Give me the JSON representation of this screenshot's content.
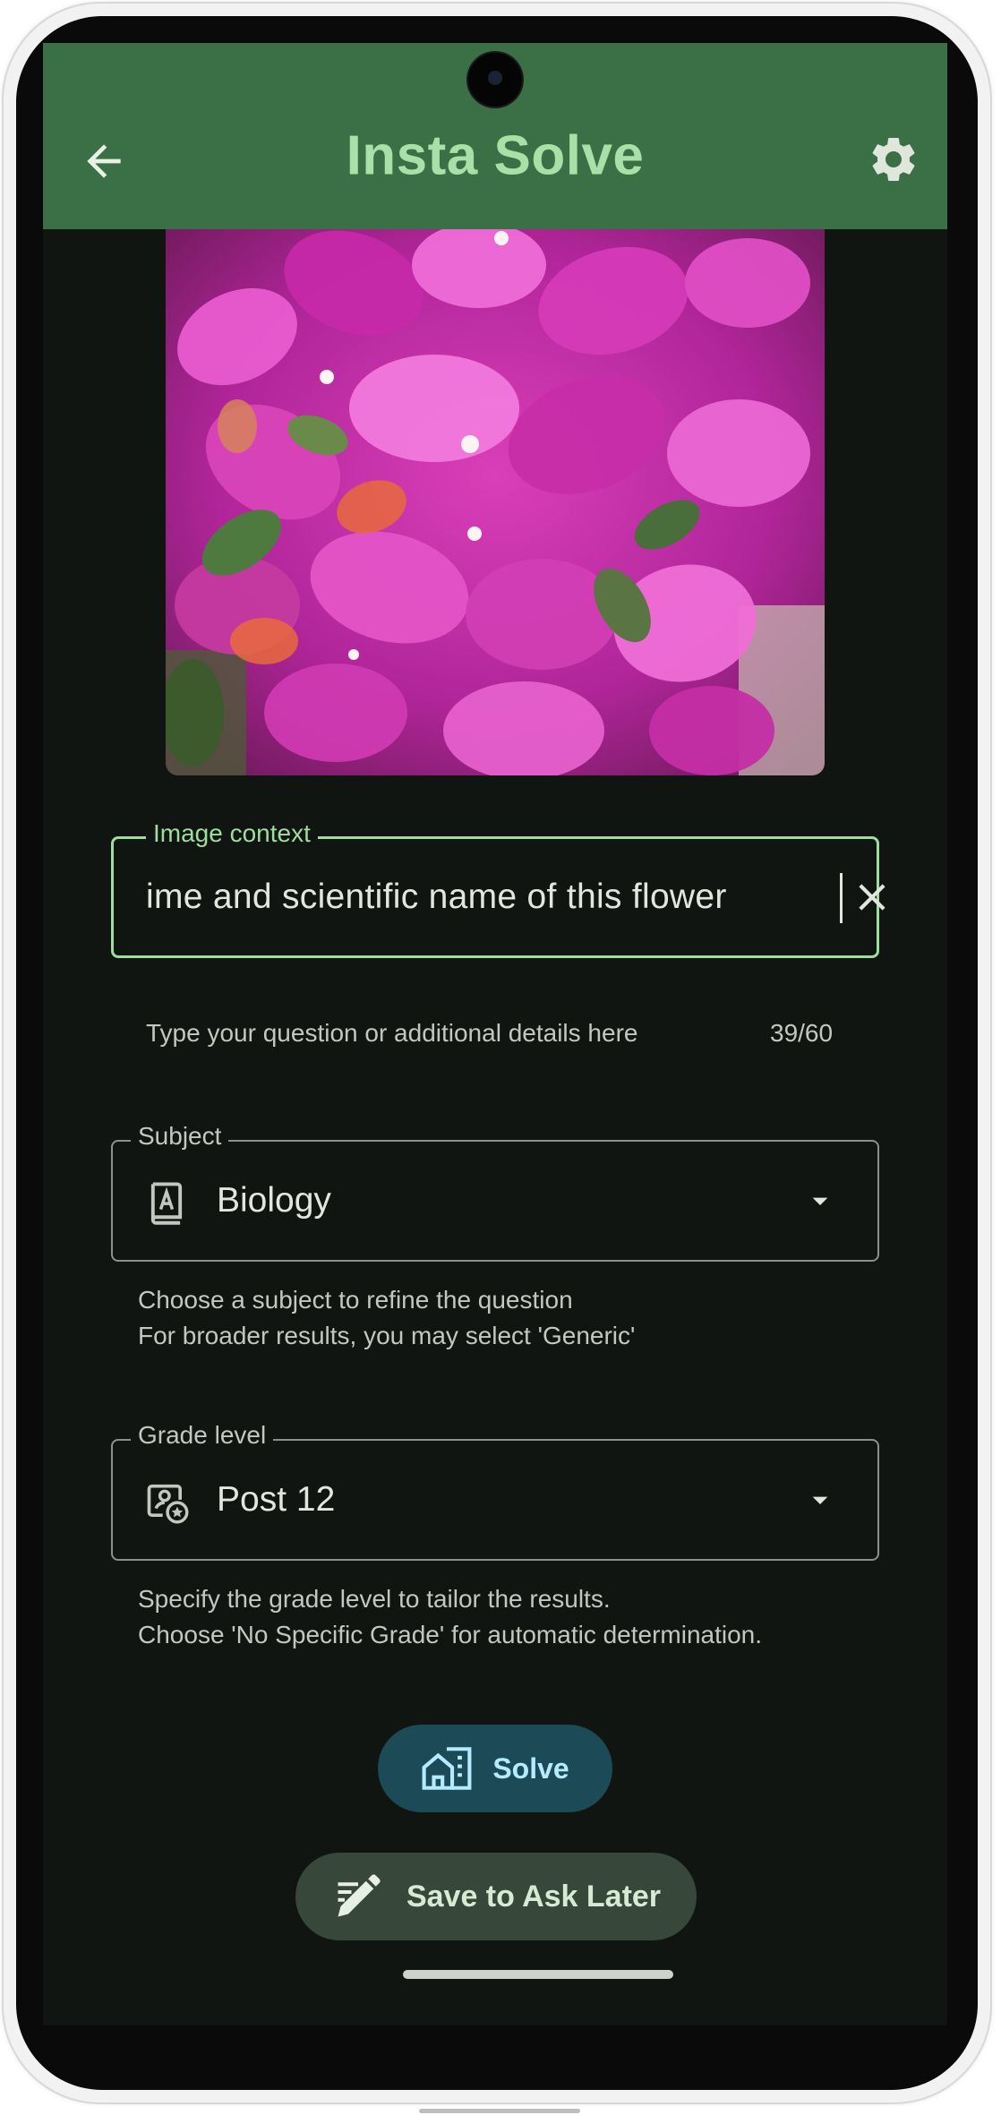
{
  "app_bar": {
    "title": "Insta Solve",
    "icons": {
      "back": "arrow-left-icon",
      "settings": "gear-icon"
    },
    "colors": {
      "bar": "#3b7046",
      "title": "#a8e0a8"
    }
  },
  "image": {
    "content": "magenta bougainvillea flowers photo"
  },
  "image_context": {
    "label": "Image context",
    "value": "ime and scientific name of this flower",
    "helper": "Type your question or additional details here",
    "counter": "39/60",
    "clear_icon": "close-icon",
    "accent": "#9fdca0"
  },
  "subject": {
    "label": "Subject",
    "value": "Biology",
    "icon": "book-a-icon",
    "helper_line1": "Choose a subject to refine the question",
    "helper_line2": "For broader results, you may select 'Generic'"
  },
  "grade": {
    "label": "Grade level",
    "value": "Post 12",
    "icon": "profile-star-icon",
    "helper_line1": "Specify the grade level to tailor the results.",
    "helper_line2": "Choose 'No Specific Grade' for automatic determination."
  },
  "actions": {
    "solve_label": "Solve",
    "solve_icon": "building-icon",
    "save_label": "Save to Ask Later",
    "save_icon": "edit-pen-icon",
    "colors": {
      "solve_bg": "#1d4a57",
      "save_bg": "#37473a"
    }
  }
}
